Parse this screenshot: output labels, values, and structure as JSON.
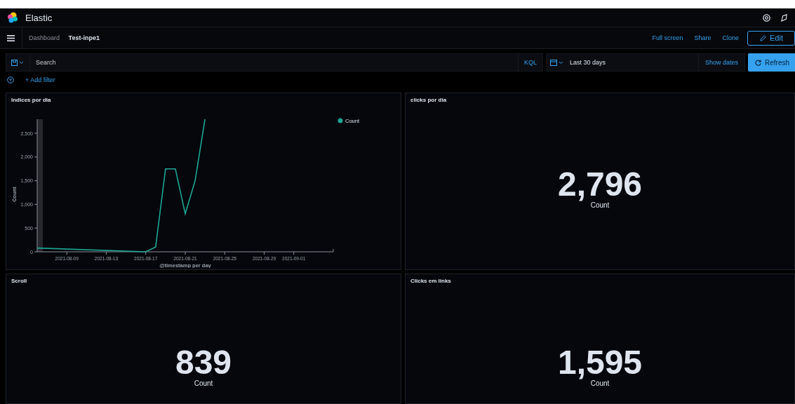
{
  "header": {
    "title": "Elastic"
  },
  "breadcrumbs": [
    {
      "label": "Dashboard",
      "current": false
    },
    {
      "label": "Test-inpe1",
      "current": true
    }
  ],
  "actions": [
    "Full screen",
    "Share",
    "Clone"
  ],
  "edit_button": "Edit",
  "query": {
    "placeholder": "Search",
    "language": "KQL",
    "time_range": "Last 30 days",
    "show_dates": "Show dates",
    "refresh": "Refresh"
  },
  "add_filter": "+ Add filter",
  "panels": [
    {
      "kind": "chart",
      "title": "Indices por dia",
      "chart_data": {
        "type": "line",
        "xlabel": "@timestamp per day",
        "ylabel": "Count",
        "x": [
          "2021-08-06",
          "2021-08-17",
          "2021-08-18",
          "2021-08-19",
          "2021-08-20",
          "2021-08-21",
          "2021-08-22",
          "2021-08-23"
        ],
        "series": [
          {
            "name": "Count",
            "color": "#1ea593",
            "values": [
              80,
              0,
              100,
              1750,
              1750,
              800,
              1500,
              2796
            ]
          }
        ],
        "xlim": [
          "2021-08-06",
          "2021-09-05"
        ],
        "ylim": [
          0,
          2796
        ],
        "xticks": [
          "2021-08-09",
          "2021-08-13",
          "2021-08-17",
          "2021-08-21",
          "2021-08-25",
          "2021-08-29",
          "2021-09-01"
        ],
        "yticks": [
          {
            "value": 0,
            "label": "0"
          },
          {
            "value": 500,
            "label": "500"
          },
          {
            "value": 1000,
            "label": "1,000"
          },
          {
            "value": 1500,
            "label": "1,500"
          },
          {
            "value": 2000,
            "label": "2,000"
          },
          {
            "value": 2500,
            "label": "2,500"
          }
        ]
      }
    },
    {
      "kind": "metric",
      "title": "clicks por dia",
      "value": "2,796",
      "label": "Count"
    },
    {
      "kind": "metric",
      "title": "Scroll",
      "value": "839",
      "label": "Count"
    },
    {
      "kind": "metric",
      "title": "Clicks em links",
      "value": "1,595",
      "label": "Count"
    }
  ]
}
